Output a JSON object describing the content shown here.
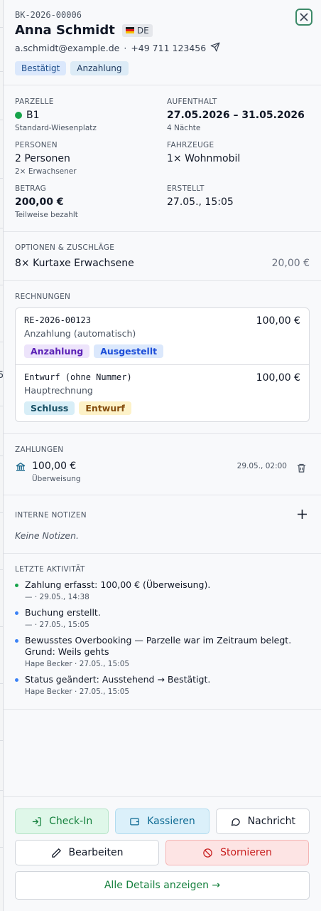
{
  "booking": {
    "id": "BK-2026-00006",
    "guest_name": "Anna Schmidt",
    "country": "DE",
    "email": "a.schmidt@example.de",
    "phone": "+49 711 123456",
    "contact_separator": "·",
    "badges": [
      "Bestätigt",
      "Anzahlung"
    ]
  },
  "details": {
    "parcel_label": "PARZELLE",
    "parcel_value": "B1",
    "parcel_sub": "Standard-Wiesenplatz",
    "stay_label": "AUFENTHALT",
    "stay_value": "27.05.2026 – 31.05.2026",
    "stay_sub": "4 Nächte",
    "persons_label": "PERSONEN",
    "persons_value": "2 Personen",
    "persons_sub": "2× Erwachsener",
    "vehicles_label": "FAHRZEUGE",
    "vehicles_value": "1× Wohnmobil",
    "amount_label": "BETRAG",
    "amount_value": "200,00 €",
    "amount_sub": "Teilweise bezahlt",
    "created_label": "ERSTELLT",
    "created_value": "27.05., 15:05"
  },
  "options": {
    "title": "OPTIONEN & ZUSCHLÄGE",
    "items": [
      {
        "label": "8× Kurtaxe Erwachsene",
        "price": "20,00 €"
      }
    ]
  },
  "invoices": {
    "title": "RECHNUNGEN",
    "items": [
      {
        "number": "RE-2026-00123",
        "amount": "100,00 €",
        "desc": "Anzahlung (automatisch)",
        "tags": [
          "Anzahlung",
          "Ausgestellt"
        ]
      },
      {
        "number": "Entwurf (ohne Nummer)",
        "amount": "100,00 €",
        "desc": "Hauptrechnung",
        "tags": [
          "Schluss",
          "Entwurf"
        ]
      }
    ]
  },
  "payments": {
    "title": "ZAHLUNGEN",
    "items": [
      {
        "amount": "100,00 €",
        "method": "Überweisung",
        "date": "29.05., 02:00"
      }
    ]
  },
  "notes": {
    "title": "INTERNE NOTIZEN",
    "empty": "Keine Notizen."
  },
  "activity": {
    "title": "LETZTE AKTIVITÄT",
    "items": [
      {
        "text": "Zahlung erfasst: 100,00 € (Überweisung).",
        "meta": "— · 29.05., 14:38",
        "color": "#16a34a"
      },
      {
        "text": "Buchung erstellt.",
        "meta": "— · 27.05., 15:05",
        "color": "#3b82f6"
      },
      {
        "text": "Bewusstes Overbooking — Parzelle war im Zeitraum belegt. Grund: Weils gehts",
        "meta": "Hape Becker · 27.05., 15:05",
        "color": "#3b82f6"
      },
      {
        "text": "Status geändert: Ausstehend → Bestätigt.",
        "meta": "Hape Becker · 27.05., 15:05",
        "color": "#3b82f6"
      }
    ]
  },
  "actions": {
    "checkin": "Check-In",
    "cashier": "Kassieren",
    "message": "Nachricht",
    "edit": "Bearbeiten",
    "cancel": "Stornieren",
    "details": "Alle Details anzeigen →"
  },
  "background_chars": [
    ",",
    ",",
    ",",
    "5",
    ",",
    ",",
    ",",
    ",",
    ",",
    ",",
    ","
  ]
}
